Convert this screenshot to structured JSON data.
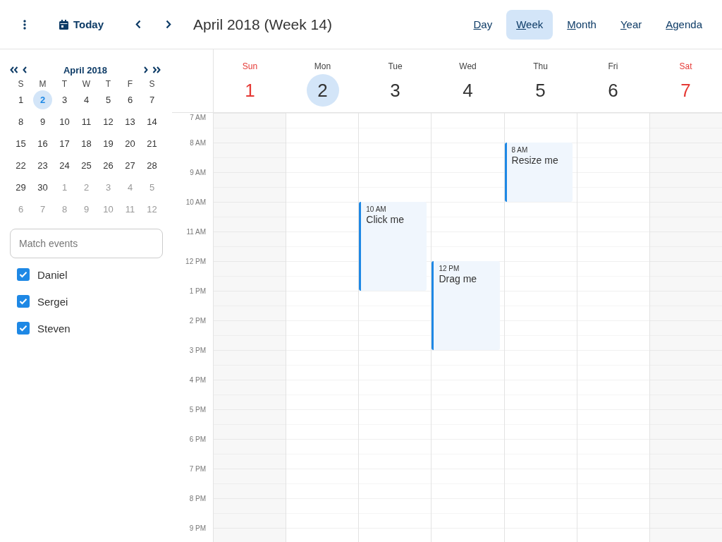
{
  "toolbar": {
    "today": "Today",
    "title": "April 2018 (Week 14)",
    "views": [
      {
        "label": "Day",
        "selected": false
      },
      {
        "label": "Week",
        "selected": true
      },
      {
        "label": "Month",
        "selected": false
      },
      {
        "label": "Year",
        "selected": false
      },
      {
        "label": "Agenda",
        "selected": false
      }
    ]
  },
  "mini_calendar": {
    "title": "April 2018",
    "weekdays": [
      "S",
      "M",
      "T",
      "W",
      "T",
      "F",
      "S"
    ],
    "weeks": [
      [
        {
          "label": "1",
          "muted": false,
          "selected": false
        },
        {
          "label": "2",
          "muted": false,
          "selected": true
        },
        {
          "label": "3",
          "muted": false,
          "selected": false
        },
        {
          "label": "4",
          "muted": false,
          "selected": false
        },
        {
          "label": "5",
          "muted": false,
          "selected": false
        },
        {
          "label": "6",
          "muted": false,
          "selected": false
        },
        {
          "label": "7",
          "muted": false,
          "selected": false
        }
      ],
      [
        {
          "label": "8",
          "muted": false,
          "selected": false
        },
        {
          "label": "9",
          "muted": false,
          "selected": false
        },
        {
          "label": "10",
          "muted": false,
          "selected": false
        },
        {
          "label": "11",
          "muted": false,
          "selected": false
        },
        {
          "label": "12",
          "muted": false,
          "selected": false
        },
        {
          "label": "13",
          "muted": false,
          "selected": false
        },
        {
          "label": "14",
          "muted": false,
          "selected": false
        }
      ],
      [
        {
          "label": "15",
          "muted": false,
          "selected": false
        },
        {
          "label": "16",
          "muted": false,
          "selected": false
        },
        {
          "label": "17",
          "muted": false,
          "selected": false
        },
        {
          "label": "18",
          "muted": false,
          "selected": false
        },
        {
          "label": "19",
          "muted": false,
          "selected": false
        },
        {
          "label": "20",
          "muted": false,
          "selected": false
        },
        {
          "label": "21",
          "muted": false,
          "selected": false
        }
      ],
      [
        {
          "label": "22",
          "muted": false,
          "selected": false
        },
        {
          "label": "23",
          "muted": false,
          "selected": false
        },
        {
          "label": "24",
          "muted": false,
          "selected": false
        },
        {
          "label": "25",
          "muted": false,
          "selected": false
        },
        {
          "label": "26",
          "muted": false,
          "selected": false
        },
        {
          "label": "27",
          "muted": false,
          "selected": false
        },
        {
          "label": "28",
          "muted": false,
          "selected": false
        }
      ],
      [
        {
          "label": "29",
          "muted": false,
          "selected": false
        },
        {
          "label": "30",
          "muted": false,
          "selected": false
        },
        {
          "label": "1",
          "muted": true,
          "selected": false
        },
        {
          "label": "2",
          "muted": true,
          "selected": false
        },
        {
          "label": "3",
          "muted": true,
          "selected": false
        },
        {
          "label": "4",
          "muted": true,
          "selected": false
        },
        {
          "label": "5",
          "muted": true,
          "selected": false
        }
      ],
      [
        {
          "label": "6",
          "muted": true,
          "selected": false
        },
        {
          "label": "7",
          "muted": true,
          "selected": false
        },
        {
          "label": "8",
          "muted": true,
          "selected": false
        },
        {
          "label": "9",
          "muted": true,
          "selected": false
        },
        {
          "label": "10",
          "muted": true,
          "selected": false
        },
        {
          "label": "11",
          "muted": true,
          "selected": false
        },
        {
          "label": "12",
          "muted": true,
          "selected": false
        }
      ]
    ]
  },
  "search": {
    "placeholder": "Match events"
  },
  "people": [
    {
      "label": "Daniel",
      "checked": true
    },
    {
      "label": "Sergei",
      "checked": true
    },
    {
      "label": "Steven",
      "checked": true
    }
  ],
  "days": [
    {
      "name": "Sun",
      "number": "1",
      "weekend": true,
      "selected": false
    },
    {
      "name": "Mon",
      "number": "2",
      "weekend": false,
      "selected": true
    },
    {
      "name": "Tue",
      "number": "3",
      "weekend": false,
      "selected": false,
      "events": [
        {
          "time": "10 AM",
          "title": "Click me"
        }
      ]
    },
    {
      "name": "Wed",
      "number": "4",
      "weekend": false,
      "selected": false,
      "events": [
        {
          "time": "12 PM",
          "title": "Drag me"
        }
      ]
    },
    {
      "name": "Thu",
      "number": "5",
      "weekend": false,
      "selected": false,
      "events": [
        {
          "time": "8 AM",
          "title": "Resize me"
        }
      ]
    },
    {
      "name": "Fri",
      "number": "6",
      "weekend": false,
      "selected": false
    },
    {
      "name": "Sat",
      "number": "7",
      "weekend": true,
      "selected": false
    }
  ],
  "hours": [
    "7 AM",
    "8 AM",
    "9 AM",
    "10 AM",
    "11 AM",
    "12 PM",
    "1 PM",
    "2 PM",
    "3 PM",
    "4 PM",
    "5 PM",
    "6 PM",
    "7 PM",
    "8 PM",
    "9 PM"
  ]
}
